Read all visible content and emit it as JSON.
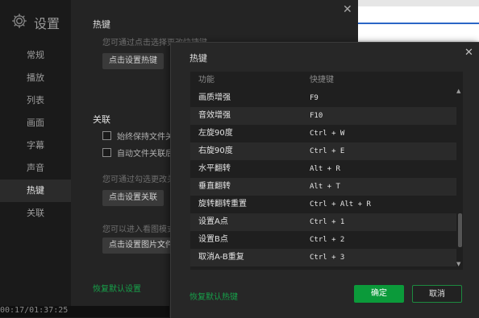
{
  "settings_window": {
    "title": "设置",
    "icon": "gear-icon",
    "sidebar": {
      "items": [
        {
          "label": "常规"
        },
        {
          "label": "播放"
        },
        {
          "label": "列表"
        },
        {
          "label": "画面"
        },
        {
          "label": "字幕"
        },
        {
          "label": "声音"
        },
        {
          "label": "热键",
          "active": true
        },
        {
          "label": "关联"
        }
      ]
    },
    "hotkey_section": {
      "title": "热键",
      "hint": "您可通过点击选择更改快捷键",
      "button_label": "点击设置热键"
    },
    "assoc_section": {
      "title": "关联",
      "checkbox1_label": "始终保持文件关",
      "checkbox2_label": "自动文件关联后",
      "hint": "您可通过勾选更改关",
      "button_label": "点击设置关联",
      "hint2": "您可以进入看图模式",
      "button2_label": "点击设置图片文件"
    },
    "reset_label": "恢复默认设置",
    "status_time": "00:17/01:37:25"
  },
  "hotkey_dialog": {
    "title": "热键",
    "columns": {
      "function": "功能",
      "shortcut": "快捷键"
    },
    "rows": [
      {
        "function": "画质增强",
        "shortcut": "F9"
      },
      {
        "function": "音效增强",
        "shortcut": "F10"
      },
      {
        "function": "左旋90度",
        "shortcut": "Ctrl + W"
      },
      {
        "function": "右旋90度",
        "shortcut": "Ctrl + E"
      },
      {
        "function": "水平翻转",
        "shortcut": "Alt + R"
      },
      {
        "function": "垂直翻转",
        "shortcut": "Alt + T"
      },
      {
        "function": "旋转翻转重置",
        "shortcut": "Ctrl + Alt + R"
      },
      {
        "function": "设置A点",
        "shortcut": "Ctrl + 1"
      },
      {
        "function": "设置B点",
        "shortcut": "Ctrl + 2"
      },
      {
        "function": "取消A-B重复",
        "shortcut": "Ctrl + 3"
      }
    ],
    "reset_label": "恢复默认热键",
    "ok_label": "确定",
    "cancel_label": "取消"
  },
  "colors": {
    "accent_green": "#0b9a3a",
    "link_green": "#17a14a",
    "dialog_bg": "#272727",
    "sidebar_bg": "#1a1a1a"
  }
}
